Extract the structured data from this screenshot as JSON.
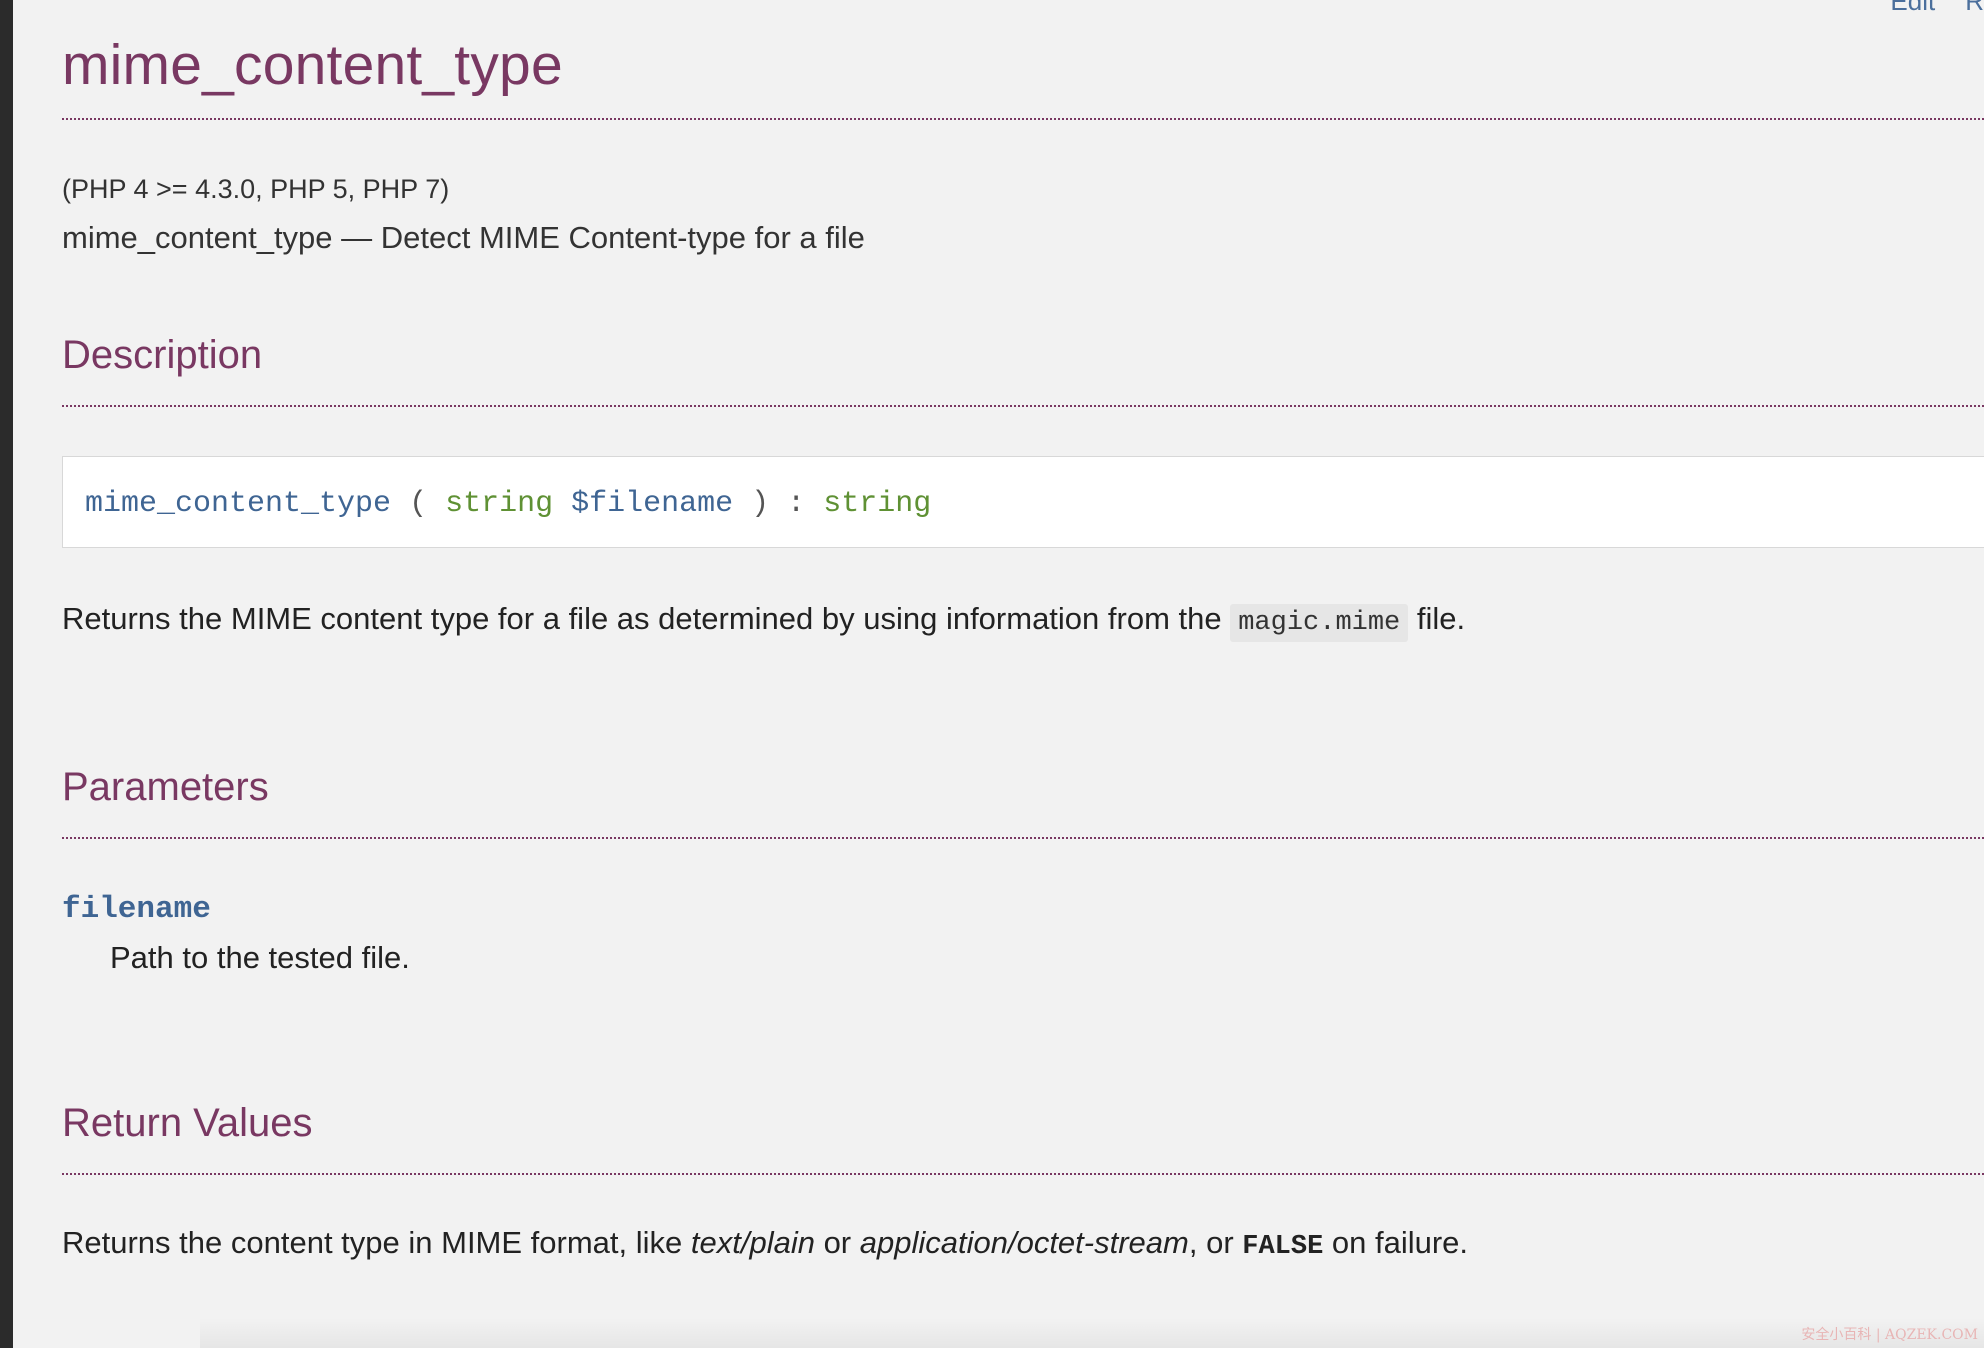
{
  "nav": {
    "edit_label": "Edit",
    "report_label": "R"
  },
  "title": "mime_content_type",
  "versions": "(PHP 4 >= 4.3.0, PHP 5, PHP 7)",
  "refpurpose": {
    "name": "mime_content_type",
    "dash": " — ",
    "purpose": "Detect MIME Content-type for a file"
  },
  "description": {
    "heading": "Description",
    "synopsis": {
      "function": "mime_content_type",
      "open_paren": " ( ",
      "param_type": "string",
      "param_var": "$filename",
      "close_paren": " ) ",
      "colon": ": ",
      "return_type": "string"
    },
    "text_before": "Returns the MIME content type for a file as determined by using information from the ",
    "code": "magic.mime",
    "text_after": " file."
  },
  "parameters": {
    "heading": "Parameters",
    "items": [
      {
        "name": "filename",
        "description": "Path to the tested file."
      }
    ]
  },
  "return_values": {
    "heading": "Return Values",
    "text_1": "Returns the content type in MIME format, like ",
    "em_1": "text/plain",
    "text_2": " or ",
    "em_2": "application/octet-stream",
    "text_3": ", or ",
    "const": "FALSE",
    "text_4": " on failure."
  },
  "watermark": "安全小百科 | AQZEK.COM",
  "colors": {
    "heading": "#793862",
    "code_blue": "#3f6593",
    "code_green": "#5f9134",
    "background": "#f2f2f2"
  }
}
